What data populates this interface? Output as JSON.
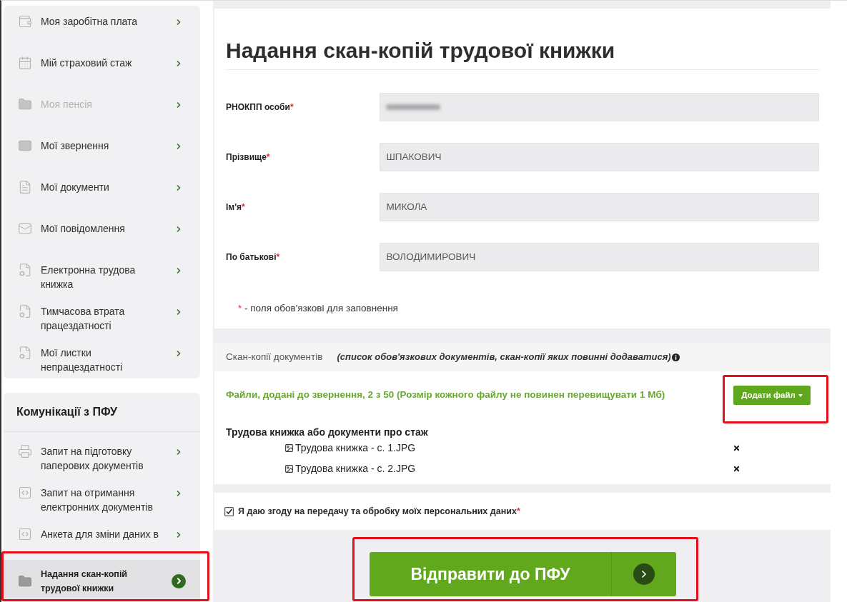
{
  "sidebar": {
    "menu_items": [
      {
        "label": "Моя заробітна плата",
        "disabled": false
      },
      {
        "label": "Мій страховий стаж",
        "disabled": false
      },
      {
        "label": "Моя пенсія",
        "disabled": true
      },
      {
        "label": "Мої звернення",
        "disabled": false
      },
      {
        "label": "Мої документи",
        "disabled": false
      },
      {
        "label": "Мої повідомлення",
        "disabled": false
      },
      {
        "label": "Електронна трудова книжка",
        "disabled": false
      },
      {
        "label": "Тимчасова втрата працездатності",
        "disabled": false
      },
      {
        "label": "Мої листки непрацездатності",
        "disabled": false
      }
    ],
    "communications": {
      "title": "Комунікації з ПФУ",
      "items": [
        {
          "label": "Запит на підготовку паперових документів",
          "selected": false,
          "highlighted": false
        },
        {
          "label": "Запит на отримання електронних документів",
          "selected": false,
          "highlighted": false
        },
        {
          "label": "Анкета для зміни даних в",
          "selected": false,
          "highlighted": false
        },
        {
          "label": "Надання скан-копій трудової книжки",
          "selected": true,
          "highlighted": true
        }
      ]
    }
  },
  "form": {
    "title": "Надання скан-копій трудової книжки",
    "fields": [
      {
        "label": "РНОКПП особи",
        "required_mark": "*",
        "redacted": true
      },
      {
        "label": "Прізвище",
        "required_mark": "*",
        "value": "ШПАКОВИЧ",
        "redacted": false
      },
      {
        "label": "Ім'я",
        "required_mark": "*",
        "value": "МИКОЛА",
        "redacted": false
      },
      {
        "label": "По батькові",
        "required_mark": "*",
        "value": "ВОЛОДИМИРОВИЧ",
        "redacted": false
      }
    ],
    "required_note": {
      "mark": "*",
      "text": "- поля обов'язкові для заповнення"
    }
  },
  "scan_copies": {
    "title": "Скан-копії документів",
    "hint": "(список обов'язкових документів, скан-копії яких повинні додаватися)",
    "files_info": "Файли, додані до звернення, 2 з 50 (Розмір кожного файлу не повинен перевищувати 1 Мб)",
    "add_button": {
      "label": "Додати файл",
      "highlighted": true
    },
    "groups": [
      {
        "title": "Трудова книжка або документи про стаж",
        "files": [
          {
            "name": "Трудова книжка - с. 1.JPG"
          },
          {
            "name": "Трудова книжка - с. 2.JPG"
          }
        ]
      }
    ]
  },
  "consent": {
    "label": "Я даю згоду на передачу та обробку моїх персональних даних",
    "required_mark": "*",
    "checked": true
  },
  "submit_button": {
    "label": "Відправити до ПФУ",
    "highlighted": true
  }
}
